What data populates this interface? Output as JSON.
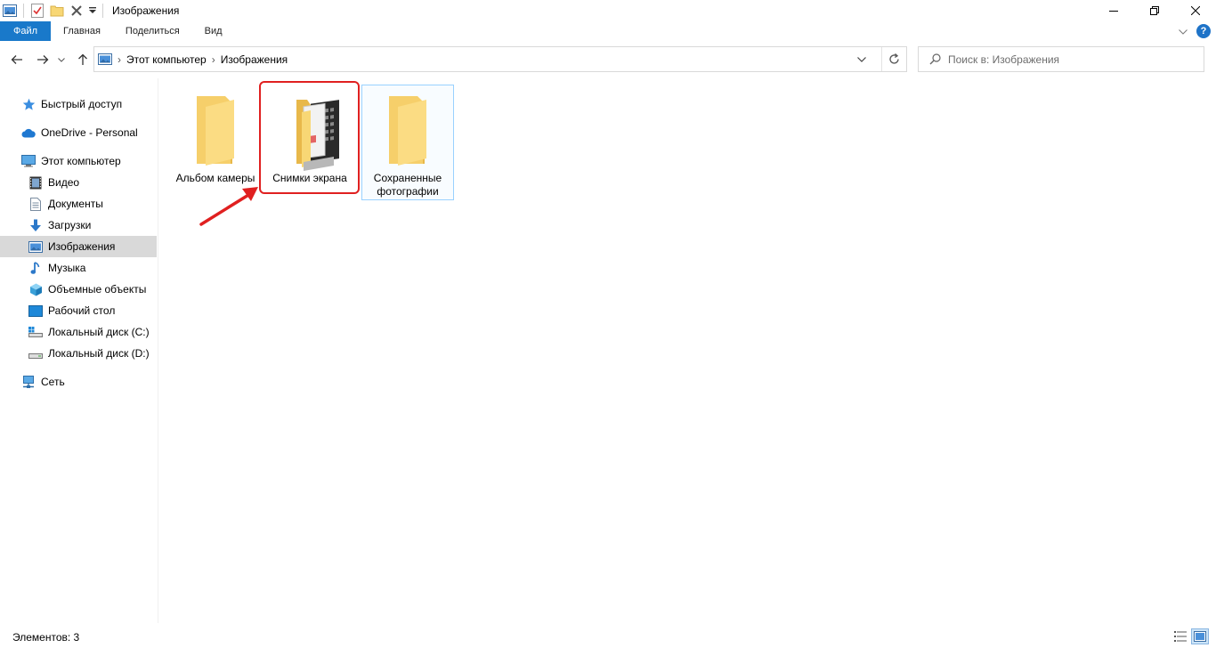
{
  "window": {
    "title": "Изображения"
  },
  "ribbon": {
    "tabs": [
      "Файл",
      "Главная",
      "Поделиться",
      "Вид"
    ]
  },
  "nav": {
    "breadcrumb": [
      "Этот компьютер",
      "Изображения"
    ],
    "search_placeholder": "Поиск в: Изображения"
  },
  "sidebar": {
    "items": [
      {
        "label": "Быстрый доступ",
        "icon": "star-icon"
      },
      {
        "label": "OneDrive - Personal",
        "icon": "cloud-icon"
      },
      {
        "label": "Этот компьютер",
        "icon": "computer-icon"
      },
      {
        "label": "Видео",
        "icon": "video-icon"
      },
      {
        "label": "Документы",
        "icon": "document-icon"
      },
      {
        "label": "Загрузки",
        "icon": "download-icon"
      },
      {
        "label": "Изображения",
        "icon": "pictures-icon"
      },
      {
        "label": "Музыка",
        "icon": "music-icon"
      },
      {
        "label": "Объемные объекты",
        "icon": "3d-objects-icon"
      },
      {
        "label": "Рабочий стол",
        "icon": "desktop-icon"
      },
      {
        "label": "Локальный диск (C:)",
        "icon": "drive-c-icon"
      },
      {
        "label": "Локальный диск (D:)",
        "icon": "drive-d-icon"
      },
      {
        "label": "Сеть",
        "icon": "network-icon"
      }
    ],
    "selected": "Изображения"
  },
  "folders": [
    {
      "label": "Альбом камеры"
    },
    {
      "label": "Снимки экрана"
    },
    {
      "label": "Сохраненные фотографии"
    }
  ],
  "status": {
    "items_text": "Элементов: 3"
  },
  "colors": {
    "accent": "#1979ca",
    "highlight": "#e02020",
    "folder": "#f8d775"
  }
}
